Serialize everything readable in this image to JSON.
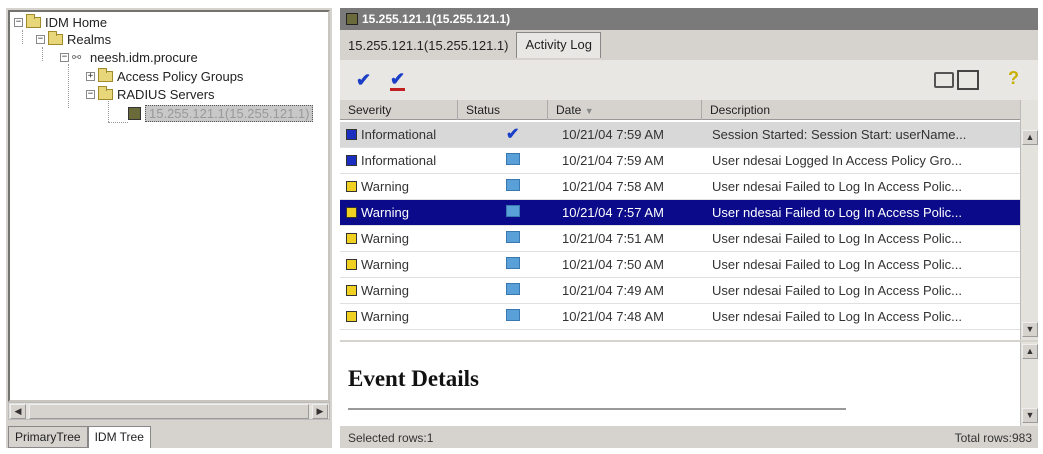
{
  "tree": {
    "nodes": [
      {
        "label": "IDM Home"
      },
      {
        "label": "Realms"
      },
      {
        "label": "neesh.idm.procure"
      },
      {
        "label": "Access Policy Groups"
      },
      {
        "label": "RADIUS Servers"
      },
      {
        "label": "15.255.121.1(15.255.121.1)"
      }
    ]
  },
  "left_tabs": [
    "PrimaryTree",
    "IDM Tree"
  ],
  "title": "15.255.121.1(15.255.121.1)",
  "tabs": [
    "15.255.121.1(15.255.121.1)",
    "Activity Log"
  ],
  "grid": {
    "headers": [
      "Severity",
      "Status",
      "Date",
      "Description"
    ],
    "sort_indicator": "▼",
    "rows": [
      {
        "severity": "Informational",
        "level": "info",
        "status": "check",
        "date": "10/21/04 7:59 AM",
        "description": "Session Started: Session Start: userName..."
      },
      {
        "severity": "Informational",
        "level": "info",
        "status": "box",
        "date": "10/21/04 7:59 AM",
        "description": "User ndesai Logged In Access Policy Gro..."
      },
      {
        "severity": "Warning",
        "level": "warn",
        "status": "box",
        "date": "10/21/04 7:58 AM",
        "description": "User ndesai Failed to Log In Access Polic..."
      },
      {
        "severity": "Warning",
        "level": "warn",
        "status": "box",
        "date": "10/21/04 7:57 AM",
        "description": "User ndesai Failed to Log In Access Polic..."
      },
      {
        "severity": "Warning",
        "level": "warn",
        "status": "box",
        "date": "10/21/04 7:51 AM",
        "description": "User ndesai Failed to Log In Access Polic..."
      },
      {
        "severity": "Warning",
        "level": "warn",
        "status": "box",
        "date": "10/21/04 7:50 AM",
        "description": "User ndesai Failed to Log In Access Polic..."
      },
      {
        "severity": "Warning",
        "level": "warn",
        "status": "box",
        "date": "10/21/04 7:49 AM",
        "description": "User ndesai Failed to Log In Access Polic..."
      },
      {
        "severity": "Warning",
        "level": "warn",
        "status": "box",
        "date": "10/21/04 7:48 AM",
        "description": "User ndesai Failed to Log In Access Polic..."
      }
    ]
  },
  "details": {
    "title": "Event Details"
  },
  "status": {
    "left": "Selected rows:1",
    "right": "Total rows:983"
  },
  "colors": {
    "selection": "#0a0a8a",
    "info": "#1a2fc0",
    "warning": "#f0d020",
    "accent": "#1a3ec8"
  }
}
